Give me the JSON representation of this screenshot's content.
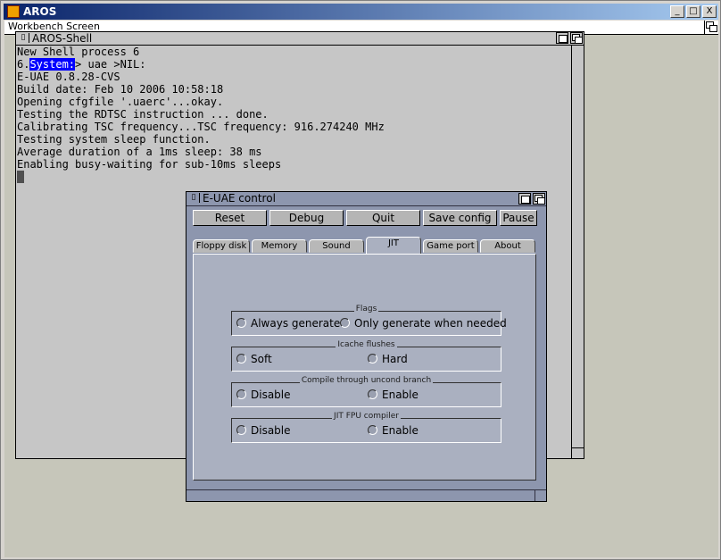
{
  "host": {
    "title": "AROS",
    "min": "_",
    "max": "□",
    "close": "X"
  },
  "screen": {
    "title": "Workbench Screen"
  },
  "shell": {
    "title": "AROS-Shell",
    "close_glyph": "▯",
    "lines": [
      "New Shell process 6",
      "Opening cfgfile '.uaerc'...okay.",
      "Testing the RDTSC instruction ... done.",
      "Calibrating TSC frequency...TSC frequency: 916.274240 MHz",
      "Testing system sleep function.",
      "Average duration of a 1ms sleep: 38 ms",
      "Enabling busy-waiting for sub-10ms sleeps"
    ],
    "prompt_num": "6.",
    "prompt_sel": "System:",
    "prompt_cmd": "> uae >NIL:",
    "version_line": "E-UAE 0.8.28-CVS",
    "build_line": "Build date: Feb 10 2006 10:58:18"
  },
  "control": {
    "title": "E-UAE control",
    "close_glyph": "▯",
    "buttons": {
      "reset": "Reset",
      "debug": "Debug",
      "quit": "Quit",
      "save": "Save config",
      "pause": "Pause"
    },
    "tabs": [
      "Floppy disk",
      "Memory",
      "Sound",
      "JIT",
      "Game port",
      "About"
    ],
    "groups": [
      {
        "label": "Flags",
        "opt1": "Always generate",
        "opt2": "Only generate when needed"
      },
      {
        "label": "Icache flushes",
        "opt1": "Soft",
        "opt2": "Hard"
      },
      {
        "label": "Compile through uncond branch",
        "opt1": "Disable",
        "opt2": "Enable"
      },
      {
        "label": "JIT FPU compiler",
        "opt1": "Disable",
        "opt2": "Enable"
      }
    ]
  }
}
